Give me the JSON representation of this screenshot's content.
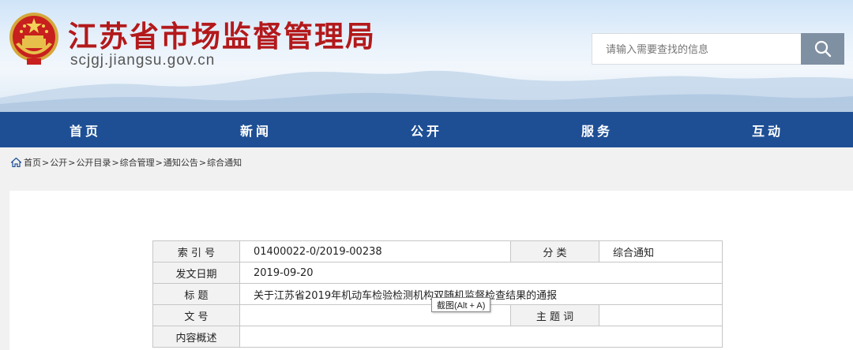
{
  "header": {
    "title": "江苏省市场监督管理局",
    "domain": "scjgj.jiangsu.gov.cn"
  },
  "search": {
    "placeholder": "请输入需要查找的信息"
  },
  "nav": {
    "items": [
      {
        "label": "首页"
      },
      {
        "label": "新闻"
      },
      {
        "label": "公开"
      },
      {
        "label": "服务"
      },
      {
        "label": "互动"
      }
    ]
  },
  "breadcrumb": {
    "items": [
      "首页",
      "公开",
      "公开目录",
      "综合管理",
      "通知公告",
      "综合通知"
    ],
    "separator": ">"
  },
  "meta": {
    "index_label": "索 引 号",
    "index_value": "01400022-0/2019-00238",
    "category_label": "分 类",
    "category_value": "综合通知",
    "date_label": "发文日期",
    "date_value": "2019-09-20",
    "title_label": "标 题",
    "title_value": "关于江苏省2019年机动车检验检测机构双随机监督检查结果的通报",
    "doc_no_label": "文 号",
    "doc_no_value": "",
    "keywords_label": "主 题 词",
    "keywords_value": "",
    "summary_label": "内容概述",
    "summary_value": ""
  },
  "tooltip": {
    "text": "截图(Alt + A)"
  },
  "colors": {
    "title_red": "#b3191b",
    "nav_blue": "#1e4f95",
    "search_button": "#7f90a3"
  }
}
